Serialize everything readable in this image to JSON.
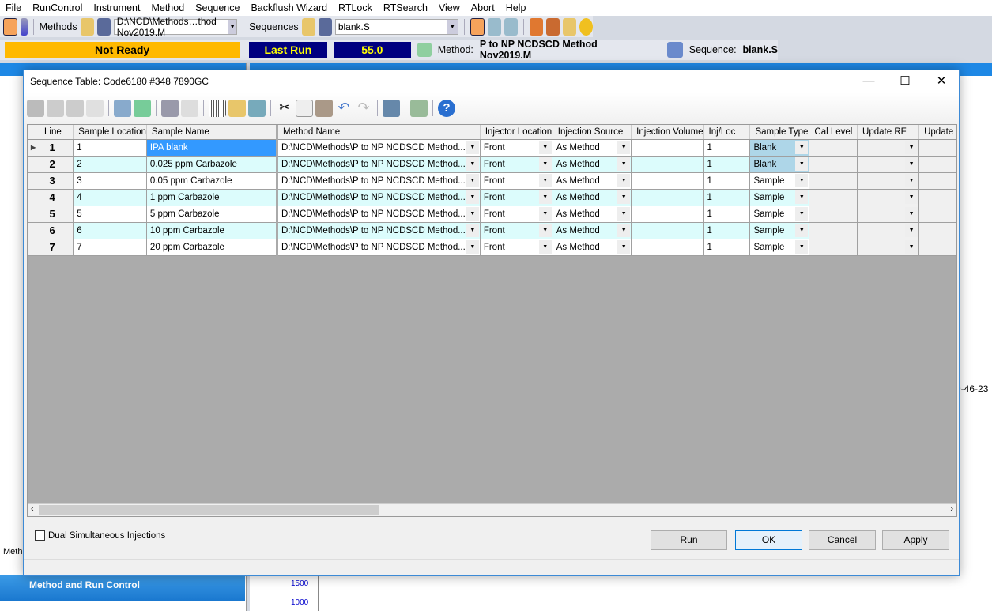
{
  "menu": [
    "File",
    "RunControl",
    "Instrument",
    "Method",
    "Sequence",
    "Backflush Wizard",
    "RTLock",
    "RTSearch",
    "View",
    "Abort",
    "Help"
  ],
  "toolbar": {
    "methods_label": "Methods",
    "method_path": "D:\\NCD\\Methods…thod Nov2019.M",
    "sequences_label": "Sequences",
    "sequence_file": "blank.S"
  },
  "status": {
    "ready": "Not Ready",
    "last_run": "Last Run",
    "value": "55.0",
    "method_label": "Method:",
    "method_name": "P to NP NCDSCD Method Nov2019.M",
    "sequence_label": "Sequence:",
    "sequence_name": "blank.S"
  },
  "left_panel": {
    "tab": "Meth",
    "nav_item": "Method and Run Control"
  },
  "right_panel": {
    "timestamp": "9-46-23",
    "axis_ticks": [
      "1500",
      "1000"
    ]
  },
  "dialog": {
    "title": "Sequence Table: Code6180 #348 7890GC",
    "columns": [
      "Line",
      "Sample Location",
      "Sample Name",
      "Method Name",
      "Injector Location",
      "Injection Source",
      "Injection Volume",
      "Inj/Loc",
      "Sample Type",
      "Cal Level",
      "Update RF",
      "Update"
    ],
    "rows": [
      {
        "line": "1",
        "loc": "1",
        "name": "IPA blank",
        "method": "D:\\NCD\\Methods\\P to NP NCDSCD Method...",
        "injloc": "Front",
        "src": "As Method",
        "vol": "",
        "inj": "1",
        "type": "Blank",
        "cal": "",
        "rf": "",
        "upd": ""
      },
      {
        "line": "2",
        "loc": "2",
        "name": "0.025 ppm Carbazole",
        "method": "D:\\NCD\\Methods\\P to NP NCDSCD Method...",
        "injloc": "Front",
        "src": "As Method",
        "vol": "",
        "inj": "1",
        "type": "Blank",
        "cal": "",
        "rf": "",
        "upd": ""
      },
      {
        "line": "3",
        "loc": "3",
        "name": "0.05 ppm Carbazole",
        "method": "D:\\NCD\\Methods\\P to NP NCDSCD Method...",
        "injloc": "Front",
        "src": "As Method",
        "vol": "",
        "inj": "1",
        "type": "Sample",
        "cal": "",
        "rf": "",
        "upd": ""
      },
      {
        "line": "4",
        "loc": "4",
        "name": "1 ppm Carbazole",
        "method": "D:\\NCD\\Methods\\P to NP NCDSCD Method...",
        "injloc": "Front",
        "src": "As Method",
        "vol": "",
        "inj": "1",
        "type": "Sample",
        "cal": "",
        "rf": "",
        "upd": ""
      },
      {
        "line": "5",
        "loc": "5",
        "name": "5 ppm Carbazole",
        "method": "D:\\NCD\\Methods\\P to NP NCDSCD Method...",
        "injloc": "Front",
        "src": "As Method",
        "vol": "",
        "inj": "1",
        "type": "Sample",
        "cal": "",
        "rf": "",
        "upd": ""
      },
      {
        "line": "6",
        "loc": "6",
        "name": "10 ppm Carbazole",
        "method": "D:\\NCD\\Methods\\P to NP NCDSCD Method...",
        "injloc": "Front",
        "src": "As Method",
        "vol": "",
        "inj": "1",
        "type": "Sample",
        "cal": "",
        "rf": "",
        "upd": ""
      },
      {
        "line": "7",
        "loc": "7",
        "name": "20 ppm Carbazole",
        "method": "D:\\NCD\\Methods\\P to NP NCDSCD Method...",
        "injloc": "Front",
        "src": "As Method",
        "vol": "",
        "inj": "1",
        "type": "Sample",
        "cal": "",
        "rf": "",
        "upd": ""
      }
    ],
    "dual_injections_label": "Dual Simultaneous Injections",
    "dual_injections_checked": false,
    "buttons": {
      "run": "Run",
      "ok": "OK",
      "cancel": "Cancel",
      "apply": "Apply"
    }
  },
  "colors": {
    "not_ready": "#ffb900",
    "last_run_bg": "#000080",
    "last_run_fg": "#ffff00",
    "selection": "#3399ff",
    "alt_row": "#dcfcfc"
  }
}
